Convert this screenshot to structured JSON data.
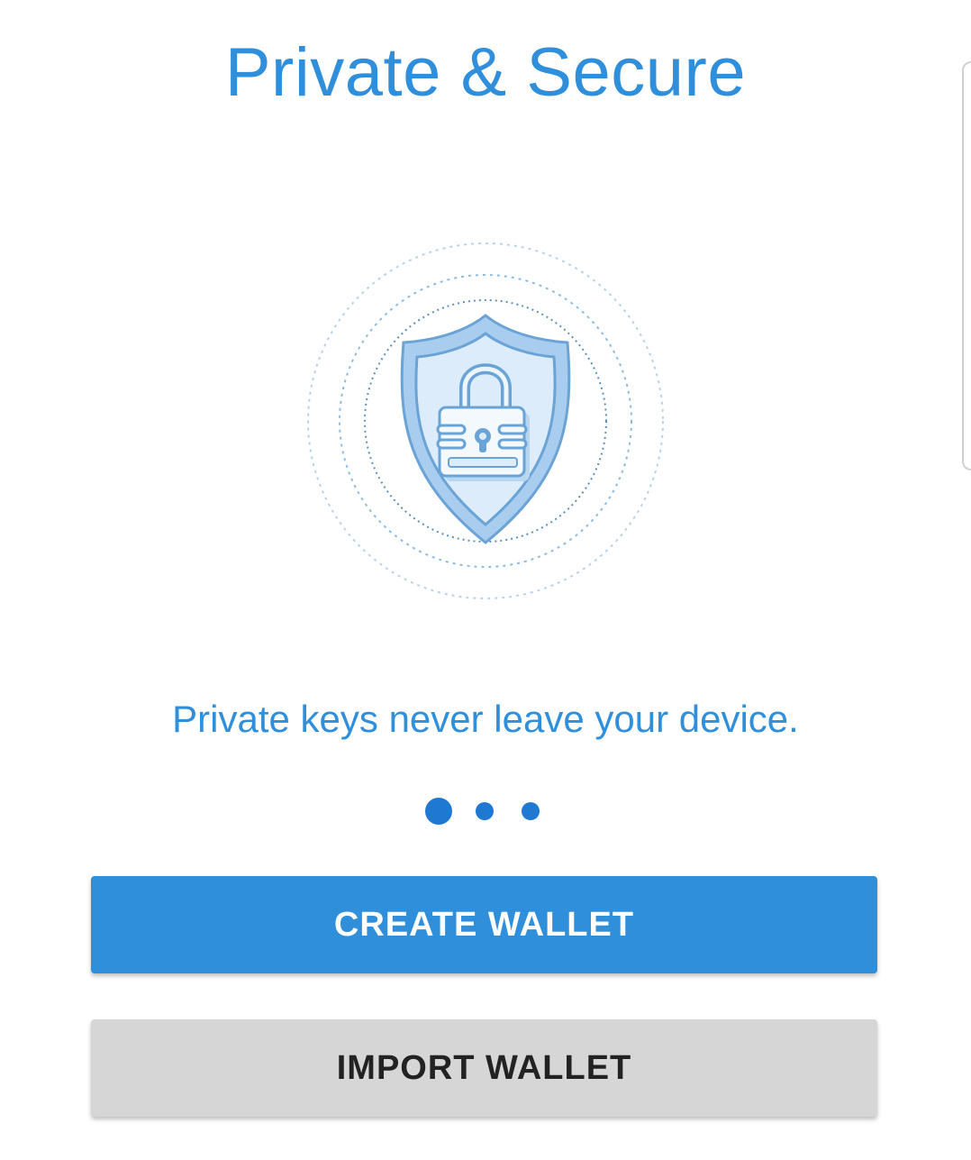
{
  "onboarding": {
    "title": "Private & Secure",
    "tagline": "Private keys never leave your device.",
    "page_indicator": {
      "current": 1,
      "total": 3
    },
    "illustration_icon": "shield-lock-icon"
  },
  "actions": {
    "create_label": "CREATE WALLET",
    "import_label": "IMPORT WALLET"
  },
  "colors": {
    "accent": "#2f8fdb",
    "dot": "#1f78d1",
    "secondary_button": "#d6d6d6",
    "secondary_text": "#222222"
  }
}
